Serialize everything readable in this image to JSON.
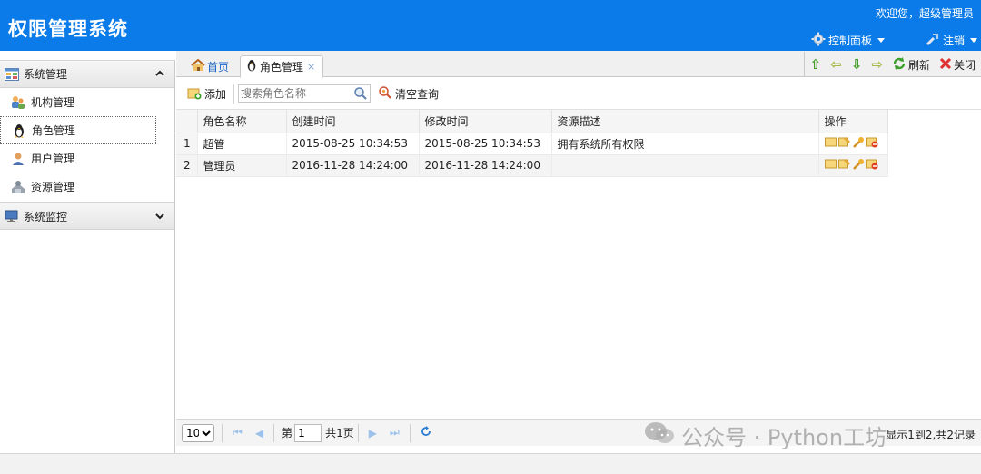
{
  "header": {
    "title": "权限管理系统",
    "welcome": "欢迎您，超级管理员",
    "control_panel": "控制面板",
    "logout": "注销"
  },
  "sidebar": {
    "sections": [
      {
        "label": "系统管理",
        "expanded": true
      },
      {
        "label": "系统监控",
        "expanded": false
      }
    ],
    "items": [
      {
        "label": "机构管理"
      },
      {
        "label": "角色管理",
        "active": true
      },
      {
        "label": "用户管理"
      },
      {
        "label": "资源管理"
      }
    ]
  },
  "tabs": {
    "home": "首页",
    "role": "角色管理",
    "close_glyph": "×"
  },
  "tab_tools": {
    "refresh": "刷新",
    "close": "关闭"
  },
  "toolbar": {
    "add": "添加",
    "search_placeholder": "搜索角色名称",
    "clear": "清空查询"
  },
  "grid": {
    "columns": [
      "角色名称",
      "创建时间",
      "修改时间",
      "资源描述",
      "操作"
    ],
    "rows": [
      {
        "n": "1",
        "name": "超管",
        "created": "2015-08-25 10:34:53",
        "modified": "2015-08-25 10:34:53",
        "desc": "拥有系统所有权限"
      },
      {
        "n": "2",
        "name": "管理员",
        "created": "2016-11-28 14:24:00",
        "modified": "2016-11-28 14:24:00",
        "desc": ""
      }
    ]
  },
  "pager": {
    "page_size": "10",
    "page_prefix": "第",
    "page": "1",
    "page_total": "共1页",
    "info": "显示1到2,共2记录"
  },
  "watermark": "公众号 · Python工坊",
  "colors": {
    "header": "#0a7be8",
    "link": "#1a64c8"
  }
}
